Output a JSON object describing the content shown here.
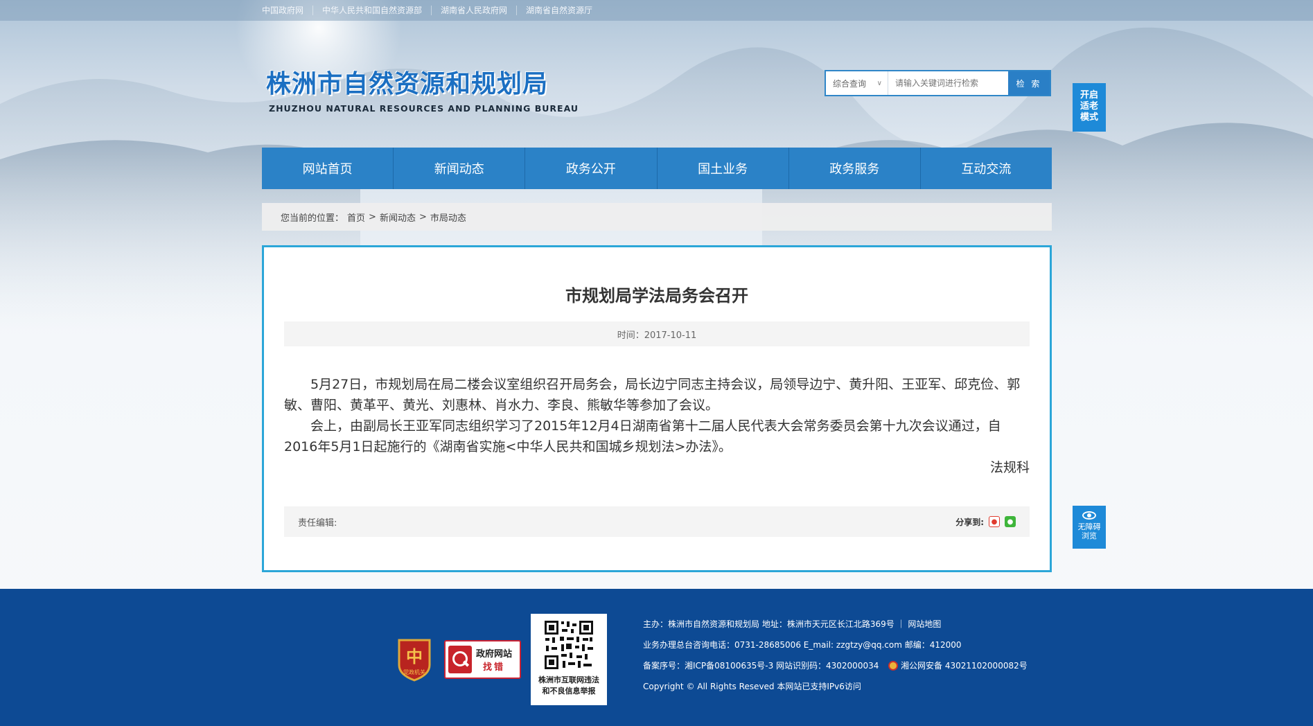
{
  "topbar": {
    "links": [
      "中国政府网",
      "中华人民共和国自然资源部",
      "湖南省人民政府网",
      "湖南省自然资源厅"
    ]
  },
  "header": {
    "logo_cn": "株洲市自然资源和规划局",
    "logo_en": "ZHUZHOU NATURAL RESOURCES AND PLANNING BUREAU"
  },
  "search": {
    "type_label": "综合查询",
    "placeholder": "请输入关键词进行检索",
    "button_label": "检 索"
  },
  "side_buttons": {
    "elder_mode": [
      "开启",
      "适老",
      "模式"
    ],
    "accessible": [
      "无障碍",
      "浏览"
    ]
  },
  "nav": {
    "items": [
      "网站首页",
      "新闻动态",
      "政务公开",
      "国土业务",
      "政务服务",
      "互动交流"
    ]
  },
  "breadcrumb": {
    "prefix": "您当前的位置：",
    "items": [
      "首页",
      ">",
      "新闻动态",
      ">",
      "市局动态"
    ]
  },
  "article": {
    "title": "市规划局学法局务会召开",
    "time_label": "时间：2017-10-11",
    "paragraphs": [
      "5月27日，市规划局在局二楼会议室组织召开局务会，局长边宁同志主持会议，局领导边宁、黄升阳、王亚军、邱克俭、郭敏、曹阳、黄革平、黄光、刘惠林、肖水力、李良、熊敏华等参加了会议。",
      "会上，由副局长王亚军同志组织学习了2015年12月4日湖南省第十二届人民代表大会常务委员会第十九次会议通过，自2016年5月1日起施行的《湖南省实施<中华人民共和国城乡规划法>办法》。"
    ],
    "signature": "法规科",
    "editor_label": "责任编辑:",
    "share_label": "分享到:"
  },
  "footer": {
    "badge_party_text": "党政机关",
    "badge_error_line1": "政府网站",
    "badge_error_line2": "找错",
    "qr_caption_line1": "株洲市互联网违法",
    "qr_caption_line2": "和不良信息举报",
    "info_rows": [
      "主办：株洲市自然资源和规划局  地址：株洲市天元区长江北路369号 ｜ 网站地图",
      "业务办理总台咨询电话：0731-28685006    E_mail:   zzgtzy@qq.com    邮编：412000",
      "备案序号：湘ICP备08100635号-3 网站识别码：4302000034",
      "Copyright © All Rights Reseved 本网站已支持IPv6访问"
    ],
    "police_text": "湘公网安备 43021102000082号"
  },
  "colors": {
    "nav_blue": "#2b82c7",
    "footer_blue": "#0d4a94",
    "article_border": "#2ba6d8",
    "logo_blue": "#1b6fc2"
  }
}
